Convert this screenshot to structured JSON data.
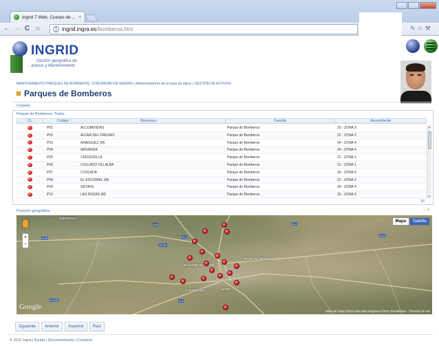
{
  "browser": {
    "tab_title": "Ingrid 7 Web. Cuerpo de ...",
    "tab_close": "×",
    "url_host": "ingrid.ingra.es",
    "url_path": "/bomberos.htm",
    "back": "←",
    "forward": "→",
    "reload": "C",
    "home": "⌂"
  },
  "logo": {
    "name": "INGRID",
    "tagline_1": "Gestión geográfica de",
    "tagline_2": "activos y Mantenimiento"
  },
  "breadcrumb": [
    "MANTENIMIENTO PARQUES DE BOMBEROS. COMUNIDAD DE MADRID",
    "Administradores de la base de datos",
    "GESTIÓN DE ACTIVOS"
  ],
  "page_title": "Parques de Bomberos",
  "carpeta": "Carpeta",
  "grid": {
    "caption": "Parque de Bomberos. Todos",
    "columns": [
      "CL",
      "Código",
      "Resumen",
      "Familia",
      "Ascendiente"
    ],
    "rows": [
      {
        "codigo": "P01",
        "resumen": "ALCOBENDAS",
        "familia": "Parque de Bomberos",
        "ascendiente": "23 - ZONA 3"
      },
      {
        "codigo": "P02",
        "resumen": "ALDEA DEL FRESNO",
        "familia": "Parque de Bomberos",
        "ascendiente": "22 - ZONA 2"
      },
      {
        "codigo": "P03",
        "resumen": "ARANJUEZ (M)",
        "familia": "Parque de Bomberos",
        "ascendiente": "24 - ZONA 4"
      },
      {
        "codigo": "P04",
        "resumen": "ARGANDA",
        "familia": "Parque de Bomberos",
        "ascendiente": "24 - ZONA 4"
      },
      {
        "codigo": "P05",
        "resumen": "CERCEDILLA",
        "familia": "Parque de Bomberos",
        "ascendiente": "21 - ZONA 1"
      },
      {
        "codigo": "P06",
        "resumen": "COLLADO VILLALBA",
        "familia": "Parque de Bomberos",
        "ascendiente": "21 - ZONA 1"
      },
      {
        "codigo": "P07",
        "resumen": "COSLADA",
        "familia": "Parque de Bomberos",
        "ascendiente": "24 - ZONA 4"
      },
      {
        "codigo": "P08",
        "resumen": "EL ESCORIAL (M)",
        "familia": "Parque de Bomberos",
        "ascendiente": "22 - ZONA 2"
      },
      {
        "codigo": "P09",
        "resumen": "GETAFE",
        "familia": "Parque de Bomberos",
        "ascendiente": "24 - ZONA 4"
      },
      {
        "codigo": "P10",
        "resumen": "LAS ROZAS (M)",
        "familia": "Parque de Bomberos",
        "ascendiente": "23 - ZONA 3"
      }
    ],
    "count": "30"
  },
  "map": {
    "header": "Posición geográfica",
    "type_map": "Mapa",
    "type_satellite": "Satélite",
    "logo": "Google",
    "copyright": "Datos de mapa ©2011 Tele Atlas Imágenes ©2011 TerraMetrics - Términos de uso",
    "places": [
      "Salamanca",
      "Las Rozas de Madrid",
      "Madrid",
      "Fuenlabrada",
      "Alcalá de Henares",
      "Getafe"
    ]
  },
  "nav_buttons": [
    "Siguiente",
    "Anterior",
    "Superior",
    "Raíz"
  ],
  "footer": {
    "copyright": "© 2011 Ingra",
    "links": [
      "Ayuda",
      "Documentación",
      "Contacto"
    ]
  }
}
